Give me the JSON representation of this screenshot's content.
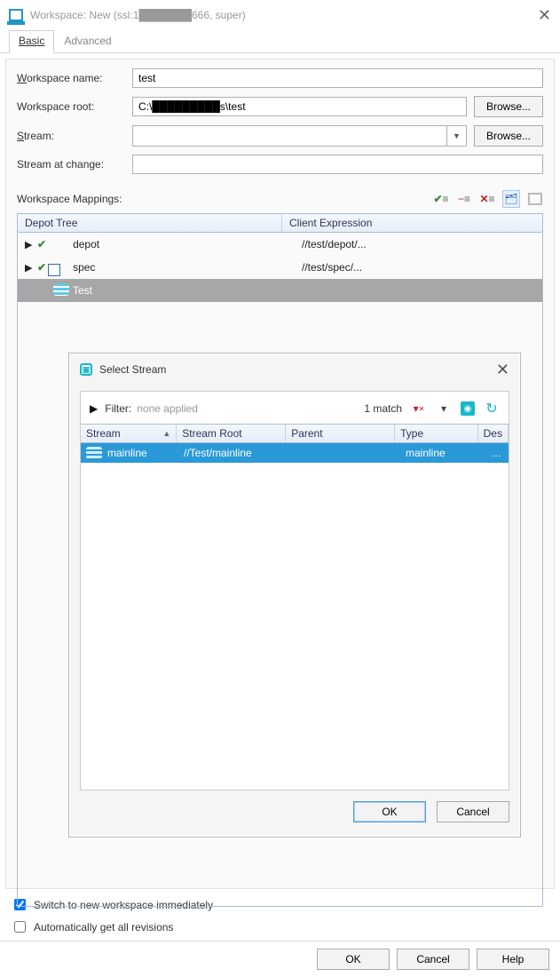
{
  "window": {
    "title": "Workspace: New (ssl:1███████666,  super)",
    "close_glyph": "✕"
  },
  "tabs": {
    "basic": "Basic",
    "advanced": "Advanced"
  },
  "form": {
    "workspace_name_label": "Workspace name:",
    "workspace_name_value": "test",
    "workspace_root_label": "Workspace root:",
    "workspace_root_value": "C:\\█████████s\\test",
    "stream_label": "Stream:",
    "stream_value": "",
    "stream_at_change_label": "Stream at change:",
    "stream_at_change_value": "",
    "browse_label": "Browse..."
  },
  "mappings": {
    "heading": "Workspace Mappings:",
    "col_depot": "Depot Tree",
    "col_client": "Client Expression",
    "rows": [
      {
        "name": "depot",
        "expr": "//test/depot/...",
        "icon": "db",
        "checked": true,
        "expandable": true
      },
      {
        "name": "spec",
        "expr": "//test/spec/...",
        "icon": "doc",
        "checked": true,
        "expandable": true
      },
      {
        "name": "Test",
        "expr": "",
        "icon": "stream",
        "checked": false,
        "expandable": false,
        "selected": true
      }
    ]
  },
  "dialog": {
    "title": "Select Stream",
    "filter_label": "Filter:",
    "filter_value": "none applied",
    "match_text": "1 match",
    "headers": {
      "stream": "Stream",
      "root": "Stream Root",
      "parent": "Parent",
      "type": "Type",
      "desc": "Des"
    },
    "row": {
      "name": "mainline",
      "root": "//Test/mainline",
      "parent": "",
      "type": "mainline",
      "desc": "…"
    },
    "ok": "OK",
    "cancel": "Cancel"
  },
  "checks": {
    "switch_label": "Switch to new workspace immediately",
    "switch_checked": true,
    "auto_label": "Automatically get all revisions",
    "auto_checked": false
  },
  "footer": {
    "ok": "OK",
    "cancel": "Cancel",
    "help": "Help"
  }
}
